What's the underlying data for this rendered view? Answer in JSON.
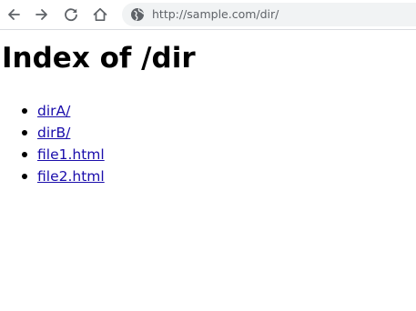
{
  "browser": {
    "back_icon": "arrow-left-icon",
    "forward_icon": "arrow-right-icon",
    "reload_icon": "reload-icon",
    "home_icon": "home-icon",
    "site_info_icon": "globe-icon",
    "url": "http://sample.com/dir/"
  },
  "page": {
    "title": "Index of /dir",
    "entries": [
      {
        "label": "dirA/"
      },
      {
        "label": "dirB/"
      },
      {
        "label": "file1.html"
      },
      {
        "label": "file2.html"
      }
    ]
  },
  "colors": {
    "link": "#1a0dab",
    "omnibox_bg": "#f1f3f4",
    "icon": "#5f6368"
  }
}
